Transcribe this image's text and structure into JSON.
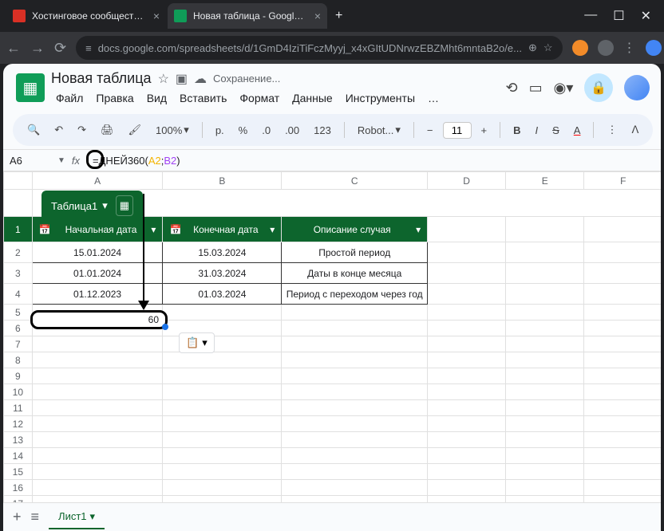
{
  "browser": {
    "tabs": [
      {
        "title": "Хостинговое сообщество «Tim"
      },
      {
        "title": "Новая таблица - Google Табл"
      }
    ],
    "url": "docs.google.com/spreadsheets/d/1GmD4IziTiFczMyyj_x4xGItUDNrwzEBZMht6mntaB2o/e..."
  },
  "doc": {
    "title": "Новая таблица",
    "status": "Сохранение..."
  },
  "menu": {
    "file": "Файл",
    "edit": "Правка",
    "view": "Вид",
    "insert": "Вставить",
    "format": "Формат",
    "data": "Данные",
    "tools": "Инструменты",
    "more": "…"
  },
  "toolbar": {
    "zoom": "100%",
    "currency": "р.",
    "percent": "%",
    "dec0": ".0",
    "dec00": ".00",
    "num123": "123",
    "font": "Robot...",
    "fontsize": "11"
  },
  "formula": {
    "cell_ref": "A6",
    "prefix": "=ДНЕЙ360(",
    "arg1": "A2",
    "sep": ";",
    "arg2": "B2",
    "suffix": ")"
  },
  "table": {
    "name": "Таблица1",
    "headers": {
      "a": "Начальная дата",
      "b": "Конечная дата",
      "c": "Описание случая"
    },
    "rows": [
      {
        "a": "15.01.2024",
        "b": "15.03.2024",
        "c": "Простой период"
      },
      {
        "a": "01.01.2024",
        "b": "31.03.2024",
        "c": "Даты в конце месяца"
      },
      {
        "a": "01.12.2023",
        "b": "01.03.2024",
        "c": "Период с переходом через год"
      }
    ]
  },
  "result": {
    "value": "60"
  },
  "columns": [
    "A",
    "B",
    "C",
    "D",
    "E",
    "F"
  ],
  "sheet": {
    "name": "Лист1"
  }
}
